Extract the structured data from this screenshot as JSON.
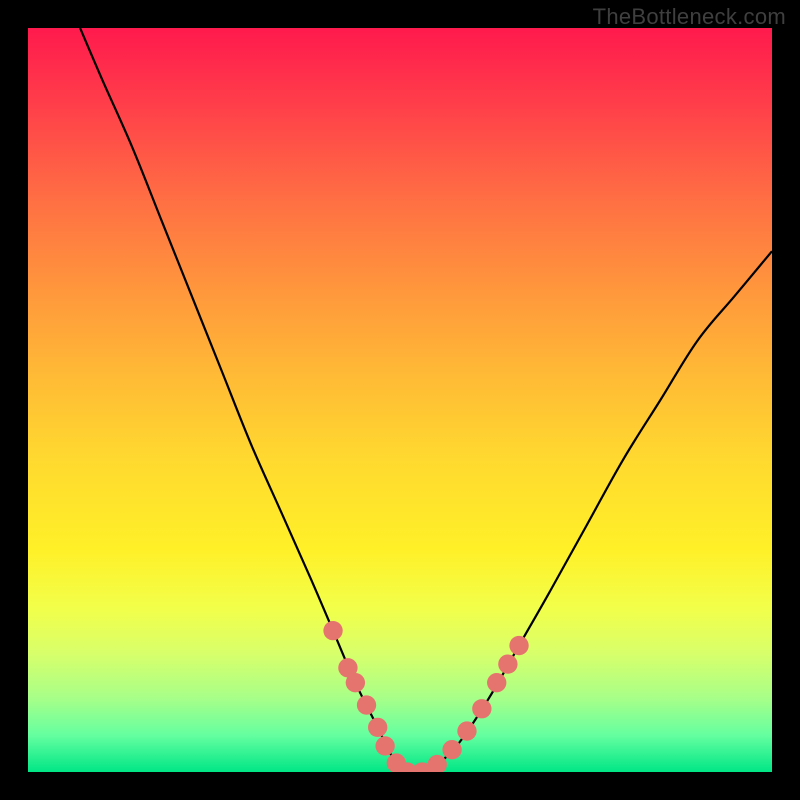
{
  "watermark": "TheBottleneck.com",
  "chart_data": {
    "type": "line",
    "title": "",
    "xlabel": "",
    "ylabel": "",
    "xlim": [
      0,
      100
    ],
    "ylim": [
      0,
      100
    ],
    "legend": false,
    "grid": false,
    "curve_points": [
      {
        "x": 7,
        "y": 100
      },
      {
        "x": 10,
        "y": 93
      },
      {
        "x": 14,
        "y": 84
      },
      {
        "x": 18,
        "y": 74
      },
      {
        "x": 22,
        "y": 64
      },
      {
        "x": 26,
        "y": 54
      },
      {
        "x": 30,
        "y": 44
      },
      {
        "x": 34,
        "y": 35
      },
      {
        "x": 38,
        "y": 26
      },
      {
        "x": 41,
        "y": 19
      },
      {
        "x": 44,
        "y": 12
      },
      {
        "x": 47,
        "y": 6
      },
      {
        "x": 49,
        "y": 2
      },
      {
        "x": 51,
        "y": 0
      },
      {
        "x": 53,
        "y": 0
      },
      {
        "x": 55,
        "y": 1
      },
      {
        "x": 58,
        "y": 4
      },
      {
        "x": 62,
        "y": 10
      },
      {
        "x": 66,
        "y": 17
      },
      {
        "x": 70,
        "y": 24
      },
      {
        "x": 75,
        "y": 33
      },
      {
        "x": 80,
        "y": 42
      },
      {
        "x": 85,
        "y": 50
      },
      {
        "x": 90,
        "y": 58
      },
      {
        "x": 95,
        "y": 64
      },
      {
        "x": 100,
        "y": 70
      }
    ],
    "marker_points": [
      {
        "x": 41,
        "y": 19
      },
      {
        "x": 43,
        "y": 14
      },
      {
        "x": 44,
        "y": 12
      },
      {
        "x": 45.5,
        "y": 9
      },
      {
        "x": 47,
        "y": 6
      },
      {
        "x": 48,
        "y": 3.5
      },
      {
        "x": 49.5,
        "y": 1.2
      },
      {
        "x": 51,
        "y": 0
      },
      {
        "x": 53,
        "y": 0
      },
      {
        "x": 55,
        "y": 1
      },
      {
        "x": 57,
        "y": 3
      },
      {
        "x": 59,
        "y": 5.5
      },
      {
        "x": 61,
        "y": 8.5
      },
      {
        "x": 63,
        "y": 12
      },
      {
        "x": 64.5,
        "y": 14.5
      },
      {
        "x": 66,
        "y": 17
      }
    ],
    "marker_radius_pct": 1.3,
    "colors": {
      "curve": "#000000",
      "markers": "#e6746e",
      "gradient_top": "#ff1a4d",
      "gradient_bottom": "#00e686"
    }
  }
}
